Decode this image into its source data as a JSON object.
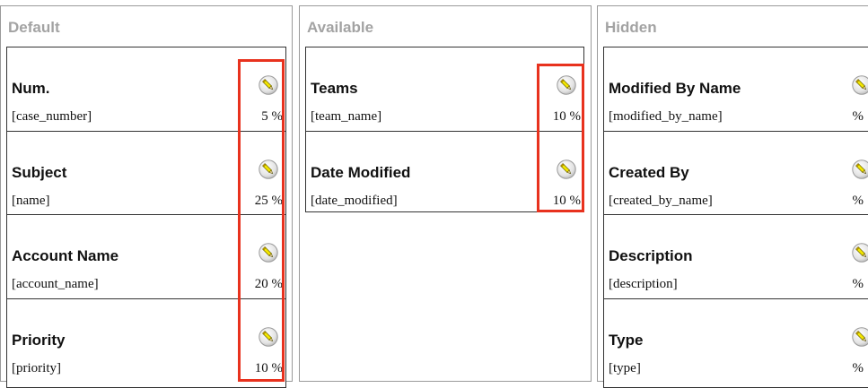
{
  "columns": {
    "default": {
      "header": "Default",
      "items": [
        {
          "label": "Num.",
          "field": "[case_number]",
          "width": "5 %"
        },
        {
          "label": "Subject",
          "field": "[name]",
          "width": "25 %"
        },
        {
          "label": "Account Name",
          "field": "[account_name]",
          "width": "20 %"
        },
        {
          "label": "Priority",
          "field": "[priority]",
          "width": "10 %"
        }
      ]
    },
    "available": {
      "header": "Available",
      "items": [
        {
          "label": "Teams",
          "field": "[team_name]",
          "width": "10 %"
        },
        {
          "label": "Date Modified",
          "field": "[date_modified]",
          "width": "10 %"
        }
      ]
    },
    "hidden": {
      "header": "Hidden",
      "items": [
        {
          "label": "Modified By Name",
          "field": "[modified_by_name]",
          "width": "%"
        },
        {
          "label": "Created By",
          "field": "[created_by_name]",
          "width": "%"
        },
        {
          "label": "Description",
          "field": "[description]",
          "width": "%"
        },
        {
          "label": "Type",
          "field": "[type]",
          "width": "%"
        }
      ]
    }
  },
  "icons": {
    "edit": "pencil-edit-icon"
  },
  "colors": {
    "highlight": "#e8321e",
    "header_text": "#a3a3a3",
    "pencil": "#f3e600"
  }
}
